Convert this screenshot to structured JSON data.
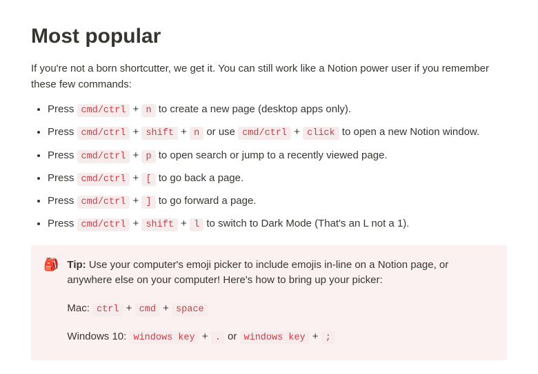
{
  "title": "Most popular",
  "intro": "If you're not a born shortcutter, we get it. You can still work like a Notion power user if you remember these few commands:",
  "word_press": "Press",
  "word_or_use": "or use",
  "word_or": "or",
  "plus": "+",
  "shortcuts": [
    {
      "keys": [
        "cmd/ctrl",
        "n"
      ],
      "desc": "to create a new page (desktop apps only)."
    },
    {
      "keys": [
        "cmd/ctrl",
        "shift",
        "n"
      ],
      "alt_keys": [
        "cmd/ctrl",
        "click"
      ],
      "desc": "to open a new Notion window."
    },
    {
      "keys": [
        "cmd/ctrl",
        "p"
      ],
      "desc": "to open search or jump to a recently viewed page."
    },
    {
      "keys": [
        "cmd/ctrl",
        "["
      ],
      "desc": "to go back a page."
    },
    {
      "keys": [
        "cmd/ctrl",
        "]"
      ],
      "desc": "to go forward a page."
    },
    {
      "keys": [
        "cmd/ctrl",
        "shift",
        "l"
      ],
      "desc": "to switch to Dark Mode (That's an L not a 1)."
    }
  ],
  "callout": {
    "icon": "🎒",
    "tip_label": "Tip:",
    "text": "Use your computer's emoji picker to include emojis in-line on a Notion page, or anywhere else on your computer! Here's how to bring up your picker:",
    "mac_label": "Mac:",
    "mac_keys": [
      "ctrl",
      "cmd",
      "space"
    ],
    "win_label": "Windows 10:",
    "win_combo_a": [
      "windows key",
      "."
    ],
    "win_combo_b": [
      "windows key",
      ";"
    ]
  }
}
